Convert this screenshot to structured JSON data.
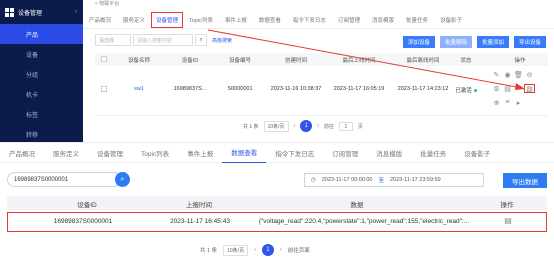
{
  "sidebar": {
    "title": "设备管理",
    "items": [
      {
        "label": "产品",
        "active": true
      },
      {
        "label": "设备",
        "active": false
      },
      {
        "label": "分组",
        "active": false
      },
      {
        "label": "机卡",
        "active": false
      },
      {
        "label": "标签",
        "active": false
      },
      {
        "label": "转移",
        "active": false
      }
    ]
  },
  "top": {
    "breadcrumb": "< 物联平台",
    "tabs": [
      "产品概况",
      "服务定义",
      "设备管理",
      "Topic列表",
      "事件上报",
      "数据查看",
      "指令下发日志",
      "订阅管理",
      "消息模版",
      "批量任务",
      "设备影子"
    ],
    "filter": {
      "select": "请选择",
      "input_placeholder": "请输入搜索内容",
      "advanced": "高级搜索"
    },
    "buttons": [
      "添加设备",
      "批量删除",
      "批量添加",
      "导出设备"
    ],
    "columns": [
      "设备名称",
      "设备ID",
      "设备编号",
      "创建时间",
      "最后上线时间",
      "最后离线时间",
      "状态",
      "操作"
    ],
    "row": {
      "name": "sw1",
      "id": "16989837S...",
      "number": "S0000001",
      "created": "2023-11-16 10:38:37",
      "online": "2023-11-17 16:05:19",
      "offline": "2023-11-17 14:23:12",
      "status": "已激活"
    },
    "pager": {
      "total": "共 1 条",
      "size": "10条/页",
      "page": "1",
      "goto": "前往",
      "unit": "页"
    }
  },
  "bottom": {
    "tabs": [
      "产品概况",
      "服务定义",
      "设备管理",
      "Topic列表",
      "事件上报",
      "数据查看",
      "指令下发日志",
      "订阅管理",
      "消息模版",
      "批量任务",
      "设备影子"
    ],
    "active_tab": "数据查看",
    "search_value": "16989837S0000001",
    "date_from": "2023-11-17 00:00:00",
    "date_sep": "至",
    "date_to": "2023-11-17 23:59:59",
    "export": "导出数据",
    "columns": [
      "设备ID",
      "上报时间",
      "数据",
      "操作"
    ],
    "row": {
      "id": "16989837S0000001",
      "time": "2023-11-17 16:45:43",
      "data": "{\"voltage_read\":220.4,\"powerstate\":1,\"power_read\":155,\"electric_read\":..."
    },
    "pager": {
      "total": "共 1 条",
      "size": "10条/页",
      "page": "1",
      "goto": "前往页面"
    }
  },
  "colors": {
    "sidebar_bg": "#0b1b4b",
    "accent": "#2f54eb",
    "highlight": "#e53935",
    "button": "#3a7bfd"
  }
}
